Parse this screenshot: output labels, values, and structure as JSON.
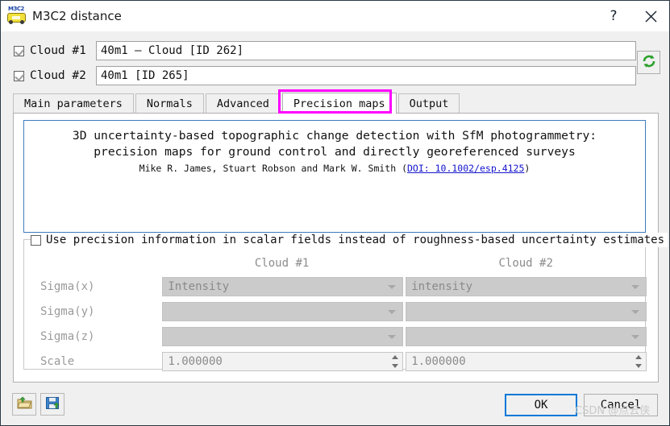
{
  "window": {
    "title": "M3C2 distance",
    "app_icon": "m3c2-icon",
    "help_label": "?",
    "close_label": "✕"
  },
  "clouds": [
    {
      "checkbox_label": "Cloud #1",
      "value": "40m1 – Cloud [ID 262]",
      "checked": true
    },
    {
      "checkbox_label": "Cloud #2",
      "value": "40m1 [ID 265]",
      "checked": true
    }
  ],
  "swap_button": {
    "icon": "refresh-swap-icon"
  },
  "tabs": [
    {
      "label": "Main parameters",
      "active": false
    },
    {
      "label": "Normals",
      "active": false
    },
    {
      "label": "Advanced",
      "active": false
    },
    {
      "label": "Precision maps",
      "active": true,
      "highlight_color": "#ff00ff"
    },
    {
      "label": "Output",
      "active": false
    }
  ],
  "citation": {
    "line1": "3D uncertainty-based topographic change detection with SfM photogrammetry:",
    "line2": "precision maps for ground control and directly georeferenced surveys",
    "authors_prefix": "Mike R. James, Stuart Robson and Mark W. Smith (",
    "doi_text": "DOI: 10.1002/esp.4125",
    "authors_suffix": ")",
    "border_color": "#3d7bbd"
  },
  "precision": {
    "use_precision_label": "Use precision information in scalar fields instead of roughness-based uncertainty estimates",
    "use_precision_checked": false,
    "column_headers": [
      "Cloud #1",
      "Cloud #2"
    ],
    "rows": [
      {
        "label": "Sigma(x)",
        "type": "combo",
        "cloud1": "Intensity",
        "cloud2": "intensity"
      },
      {
        "label": "Sigma(y)",
        "type": "combo",
        "cloud1": "",
        "cloud2": ""
      },
      {
        "label": "Sigma(z)",
        "type": "combo",
        "cloud1": "",
        "cloud2": ""
      },
      {
        "label": "Scale",
        "type": "spin",
        "cloud1": "1.000000",
        "cloud2": "1.000000"
      }
    ]
  },
  "footer": {
    "load_icon": "open-folder-icon",
    "save_icon": "save-floppy-icon",
    "ok_label": "OK",
    "cancel_label": "Cancel",
    "ok_accent": "#0078d7"
  },
  "watermark": {
    "text": "CSDN @点云侠"
  }
}
